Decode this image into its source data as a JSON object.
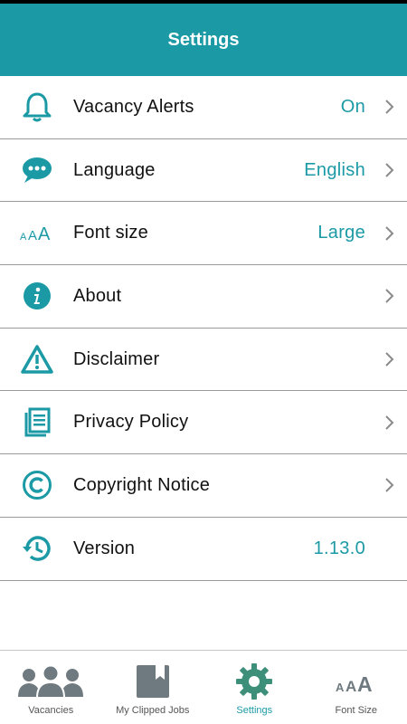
{
  "colors": {
    "accent": "#1b9aa6",
    "header_bg": "#1b9aa6",
    "divider": "#9a9a9a",
    "inactive_icon": "#6f7a80",
    "active_icon": "#3d8f7a"
  },
  "header": {
    "title": "Settings"
  },
  "settings": {
    "items": [
      {
        "label": "Vacancy Alerts",
        "value": "On",
        "icon": "bell-icon",
        "chevron": true
      },
      {
        "label": "Language",
        "value": "English",
        "icon": "chat-bubble-icon",
        "chevron": true
      },
      {
        "label": "Font size",
        "value": "Large",
        "icon": "font-size-icon",
        "chevron": true
      },
      {
        "label": "About",
        "value": "",
        "icon": "info-icon",
        "chevron": true
      },
      {
        "label": "Disclaimer",
        "value": "",
        "icon": "warning-icon",
        "chevron": true
      },
      {
        "label": "Privacy Policy",
        "value": "",
        "icon": "document-icon",
        "chevron": true
      },
      {
        "label": "Copyright Notice",
        "value": "",
        "icon": "copyright-icon",
        "chevron": true
      },
      {
        "label": "Version",
        "value": "1.13.0",
        "icon": "history-icon",
        "chevron": false
      }
    ]
  },
  "tabbar": {
    "items": [
      {
        "label": "Vacancies",
        "icon": "people-icon",
        "active": false
      },
      {
        "label": "My Clipped Jobs",
        "icon": "bookmark-book-icon",
        "active": false
      },
      {
        "label": "Settings",
        "icon": "gear-icon",
        "active": true
      },
      {
        "label": "Font Size",
        "icon": "font-size-icon",
        "active": false
      }
    ]
  }
}
